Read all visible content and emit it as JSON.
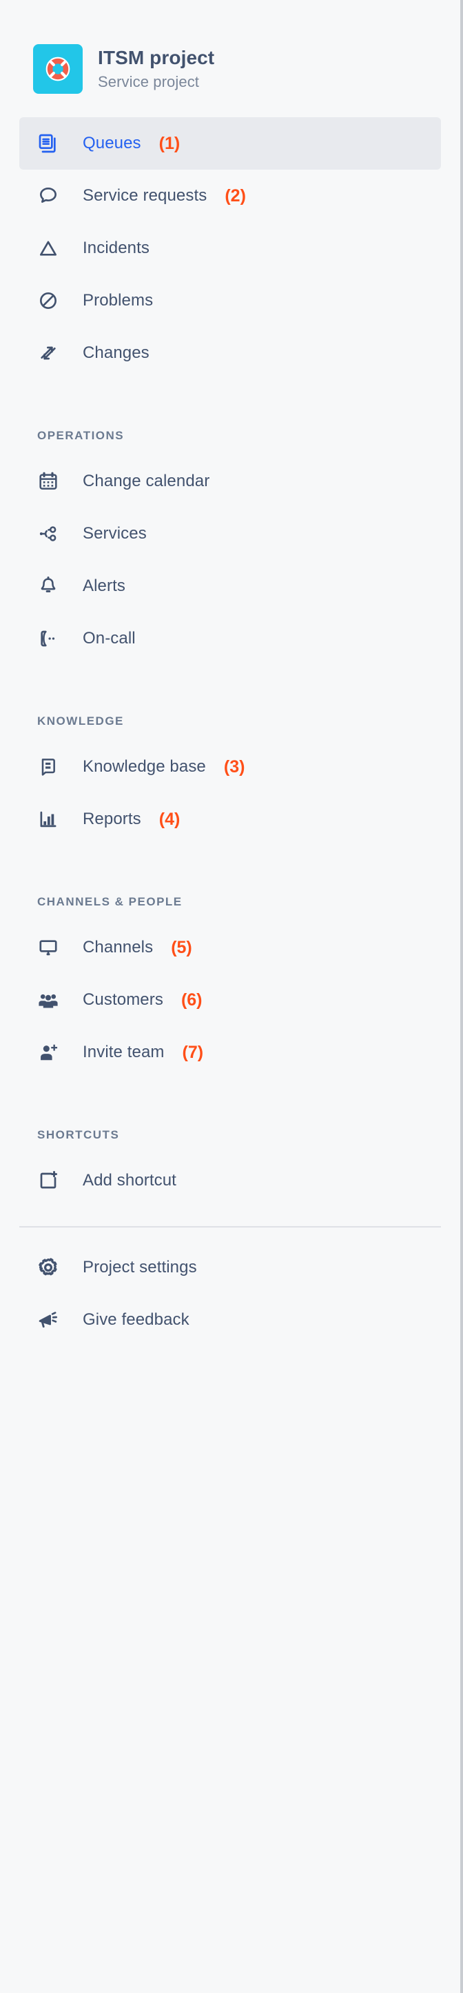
{
  "project": {
    "avatar_icon": "lifebuoy-icon",
    "avatar_color": "#22c6e8",
    "title": "ITSM project",
    "subtitle": "Service project"
  },
  "colors": {
    "sidebar_bg": "#f7f8f9",
    "selected_bg": "#e8eaee",
    "selected_text": "#2461f0",
    "text": "#42526e",
    "muted_text": "#6b7a90",
    "marker": "#ff4f18"
  },
  "nav": {
    "primary": [
      {
        "label": "Queues",
        "icon": "queues-icon",
        "selected": true,
        "marker": "(1)"
      },
      {
        "label": "Service requests",
        "icon": "chat-bubble-icon",
        "selected": false,
        "marker": "(2)"
      },
      {
        "label": "Incidents",
        "icon": "warning-triangle-icon",
        "selected": false,
        "marker": ""
      },
      {
        "label": "Problems",
        "icon": "circle-slash-icon",
        "selected": false,
        "marker": ""
      },
      {
        "label": "Changes",
        "icon": "arrows-swap-icon",
        "selected": false,
        "marker": ""
      }
    ],
    "sections": [
      {
        "heading": "OPERATIONS",
        "items": [
          {
            "label": "Change calendar",
            "icon": "calendar-icon",
            "marker": ""
          },
          {
            "label": "Services",
            "icon": "node-branch-icon",
            "marker": ""
          },
          {
            "label": "Alerts",
            "icon": "bell-icon",
            "marker": ""
          },
          {
            "label": "On-call",
            "icon": "phone-ring-icon",
            "marker": ""
          }
        ]
      },
      {
        "heading": "KNOWLEDGE",
        "items": [
          {
            "label": "Knowledge base",
            "icon": "book-icon",
            "marker": "(3)"
          },
          {
            "label": "Reports",
            "icon": "bar-chart-icon",
            "marker": "(4)"
          }
        ]
      },
      {
        "heading": "CHANNELS & PEOPLE",
        "items": [
          {
            "label": "Channels",
            "icon": "monitor-icon",
            "marker": "(5)"
          },
          {
            "label": "Customers",
            "icon": "people-group-icon",
            "marker": "(6)"
          },
          {
            "label": "Invite team",
            "icon": "person-add-icon",
            "marker": "(7)"
          }
        ]
      },
      {
        "heading": "SHORTCUTS",
        "items": [
          {
            "label": "Add shortcut",
            "icon": "add-shortcut-icon",
            "marker": ""
          }
        ]
      }
    ],
    "footer": [
      {
        "label": "Project settings",
        "icon": "gear-icon",
        "marker": ""
      },
      {
        "label": "Give feedback",
        "icon": "megaphone-icon",
        "marker": ""
      }
    ]
  }
}
